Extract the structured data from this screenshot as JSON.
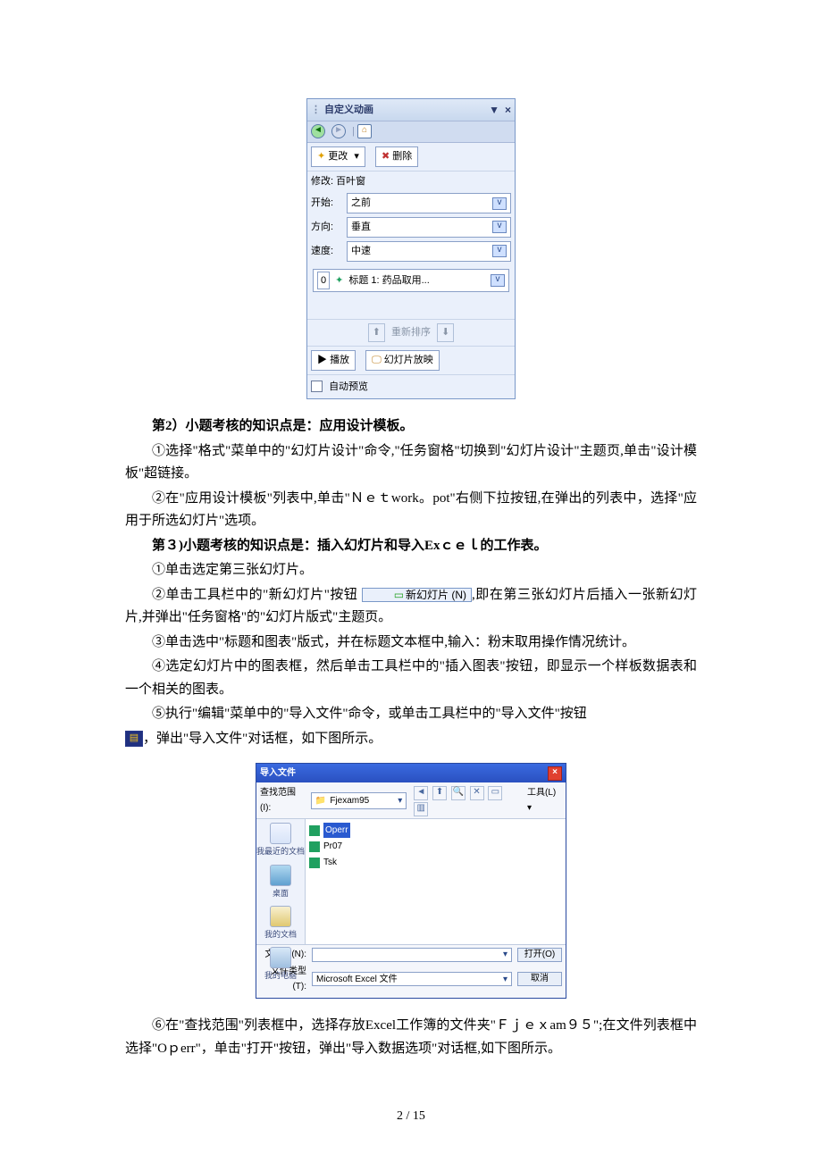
{
  "panel_anim": {
    "title": "自定义动画",
    "change_btn": "更改",
    "delete_btn": "删除",
    "modify_label": "修改: 百叶窗",
    "rows": {
      "start": {
        "label": "开始:",
        "value": "之前"
      },
      "direction": {
        "label": "方向:",
        "value": "垂直"
      },
      "speed": {
        "label": "速度:",
        "value": "中速"
      }
    },
    "list_index": "0",
    "list_item": "标题 1: 药品取用...",
    "reorder": "重新排序",
    "play": "播放",
    "slideshow": "幻灯片放映",
    "auto_preview": "自动预览"
  },
  "text": {
    "q2_heading": "第2）小题考核的知识点是：应用设计模板。",
    "q2_1a": "①选择\"格式\"菜单中的\"幻灯片设计\"命令,\"任务窗格\"切换到\"幻灯片设计\"主题页,单击\"设计模板\"超链接。",
    "q2_2": "②在\"应用设计模板\"列表中,单击\"Ｎｅｔwork。pot\"右侧下拉按钮,在弹出的列表中，选择\"应用于所选幻灯片\"选项。",
    "q3_heading": "第３)小题考核的知识点是：插入幻灯片和导入Exｃｅｌ的工作表。",
    "q3_1": "①单击选定第三张幻灯片。",
    "q3_2a": "②单击工具栏中的\"新幻灯片\"按钮",
    "q3_2b": ",即在第三张幻灯片后插入一张新幻灯片,并弹出\"任务窗格\"的\"幻灯片版式\"主题页。",
    "q3_3": "③单击选中\"标题和图表\"版式，并在标题文本框中,输入：粉末取用操作情况统计。",
    "q3_4": "④选定幻灯片中的图表框，然后单击工具栏中的\"插入图表\"按钮，即显示一个样板数据表和一个相关的图表。",
    "q3_5a": "⑤执行\"编辑\"菜单中的\"导入文件\"命令，或单击工具栏中的\"导入文件\"按钮",
    "q3_5b": "，弹出\"导入文件\"对话框，如下图所示。",
    "q3_6": "⑥在\"查找范围\"列表框中，选择存放Excel工作簿的文件夹\"Ｆｊｅｘam９５\";在文件列表框中选择\"Oｐerr\"，单击\"打开\"按钮，弹出\"导入数据选项\"对话框,如下图所示。"
  },
  "newslide_btn": "新幻灯片 (N)",
  "dialog_import": {
    "title": "导入文件",
    "lookin_label": "查找范围(I):",
    "lookin_value": "Fjexam95",
    "tools_label": "工具(L)",
    "places": {
      "recent": "我最近的文档",
      "desktop": "桌面",
      "mydocs": "我的文档",
      "mycomp": "我的电脑"
    },
    "files": {
      "f1": "Operr",
      "f2": "Pr07",
      "f3": "Tsk"
    },
    "filename_label": "文件名(N):",
    "filetype_label": "文件类型(T):",
    "filetype_value": "Microsoft Excel 文件",
    "open_btn": "打开(O)",
    "cancel_btn": "取消"
  },
  "page_number": "2 / 15"
}
